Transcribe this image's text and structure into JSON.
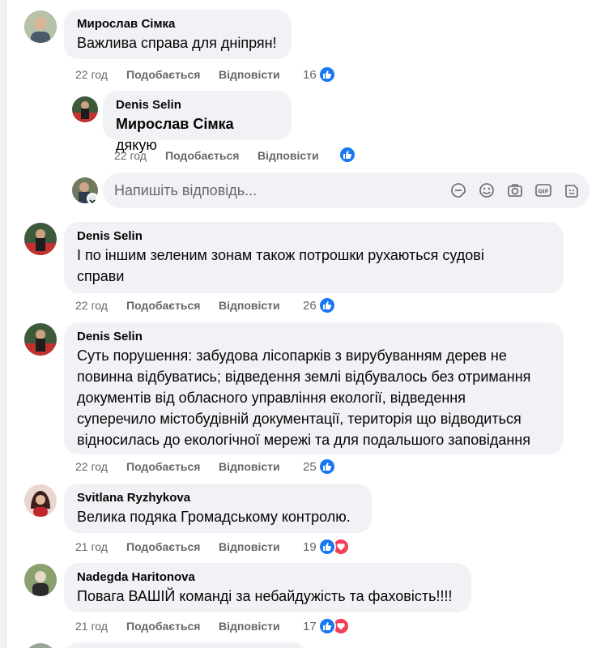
{
  "comments": [
    {
      "author": "Мирослав Сімка",
      "text": "Важлива справа для дніпрян!",
      "time": "22 год",
      "like": "Подобається",
      "reply": "Відповісти",
      "count": "16"
    },
    {
      "author": "Denis Selin",
      "mention": "Мирослав Сімка",
      "text": "дякую",
      "time": "22 год",
      "like": "Подобається",
      "reply": "Відповісти",
      "count": ""
    },
    {
      "author": "Denis Selin",
      "text1": "І по іншим зеленим зонам також потрошки рухаються судові",
      "text2": "справи",
      "time": "22 год",
      "like": "Подобається",
      "reply": "Відповісти",
      "count": "26"
    },
    {
      "author": "Denis Selin",
      "lines": [
        "Суть порушення: забудова лісопарків з вирубуванням дерев не",
        "повинна відбуватись; відведення землі відбувалось без отримання",
        "документів від обласного управління екології, відведення",
        "суперечило містобудівній документації, територія що відводиться",
        "відносилась до екологічної мережі та для подальшого заповідання"
      ],
      "time": "22 год",
      "like": "Подобається",
      "reply": "Відповісти",
      "count": "25"
    },
    {
      "author": "Svitlana Ryzhykova",
      "text": "Велика подяка Громадському контролю.",
      "time": "21 год",
      "like": "Подобається",
      "reply": "Відповісти",
      "count": "19"
    },
    {
      "author": "Nadegda Haritonova",
      "text": "Повага ВАШІЙ команді за небайдужість та фаховість!!!!",
      "time": "21 год",
      "like": "Подобається",
      "reply": "Відповісти",
      "count": "17"
    }
  ],
  "reply_input": {
    "placeholder": "Напишіть відповідь..."
  },
  "icons": [
    "sticker-icon",
    "emoji-icon",
    "camera-icon",
    "gif-icon",
    "avatar-sticker-icon"
  ],
  "colors": {
    "like": "#1877f2",
    "heart": "#f33e58",
    "bubble": "#f0f2f5",
    "meta": "#65676b"
  }
}
